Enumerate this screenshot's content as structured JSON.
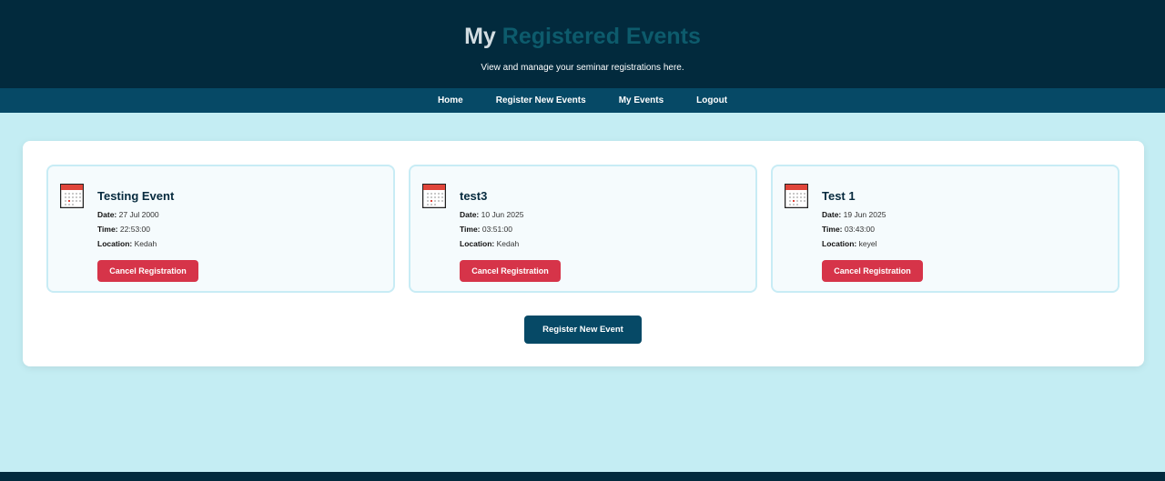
{
  "header": {
    "title_part1": "My",
    "title_part2": "Registered Events",
    "subtitle": "View and manage your seminar registrations here."
  },
  "nav": {
    "items": [
      {
        "label": "Home"
      },
      {
        "label": "Register New Events"
      },
      {
        "label": "My Events"
      },
      {
        "label": "Logout"
      }
    ]
  },
  "events": [
    {
      "title": "Testing Event",
      "date_label": "Date:",
      "date": "27 Jul 2000",
      "time_label": "Time:",
      "time": "22:53:00",
      "location_label": "Location:",
      "location": "Kedah",
      "action": "Cancel Registration"
    },
    {
      "title": "test3",
      "date_label": "Date:",
      "date": "10 Jun 2025",
      "time_label": "Time:",
      "time": "03:51:00",
      "location_label": "Location:",
      "location": "Kedah",
      "action": "Cancel Registration"
    },
    {
      "title": "Test 1",
      "date_label": "Date:",
      "date": "19 Jun 2025",
      "time_label": "Time:",
      "time": "03:43:00",
      "location_label": "Location:",
      "location": "keyel",
      "action": "Cancel Registration"
    }
  ],
  "register_button": "Register New Event",
  "icons": {
    "event": "calendar-icon"
  },
  "colors": {
    "header_bg": "#022a3d",
    "nav_bg": "#064966",
    "page_bg": "#c4edf3",
    "cancel": "#d63449",
    "primary": "#064966"
  }
}
